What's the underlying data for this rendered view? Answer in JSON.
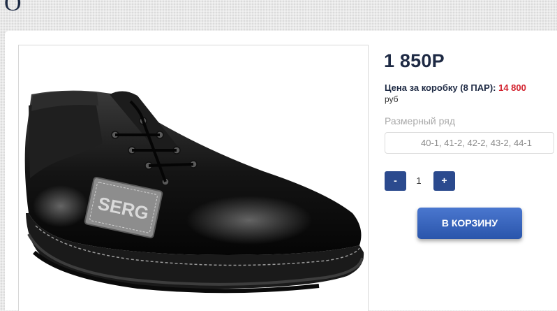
{
  "header": {
    "letter": "O"
  },
  "product": {
    "image": {
      "badge_text": "SERG"
    },
    "price": "1 850Р",
    "box_price": {
      "label": "Цена за коробку (8 ПАР):",
      "value": "14 800",
      "unit": "руб"
    },
    "size_label": "Размерный ряд",
    "size_value": "40-1, 41-2, 42-2, 43-2, 44-1",
    "quantity": {
      "minus": "-",
      "value": "1",
      "plus": "+"
    },
    "cart_button": "В КОРЗИНУ"
  },
  "colors": {
    "accent": "#2b4a8e",
    "price_red": "#d3232f",
    "text_dark": "#1e2a44"
  }
}
